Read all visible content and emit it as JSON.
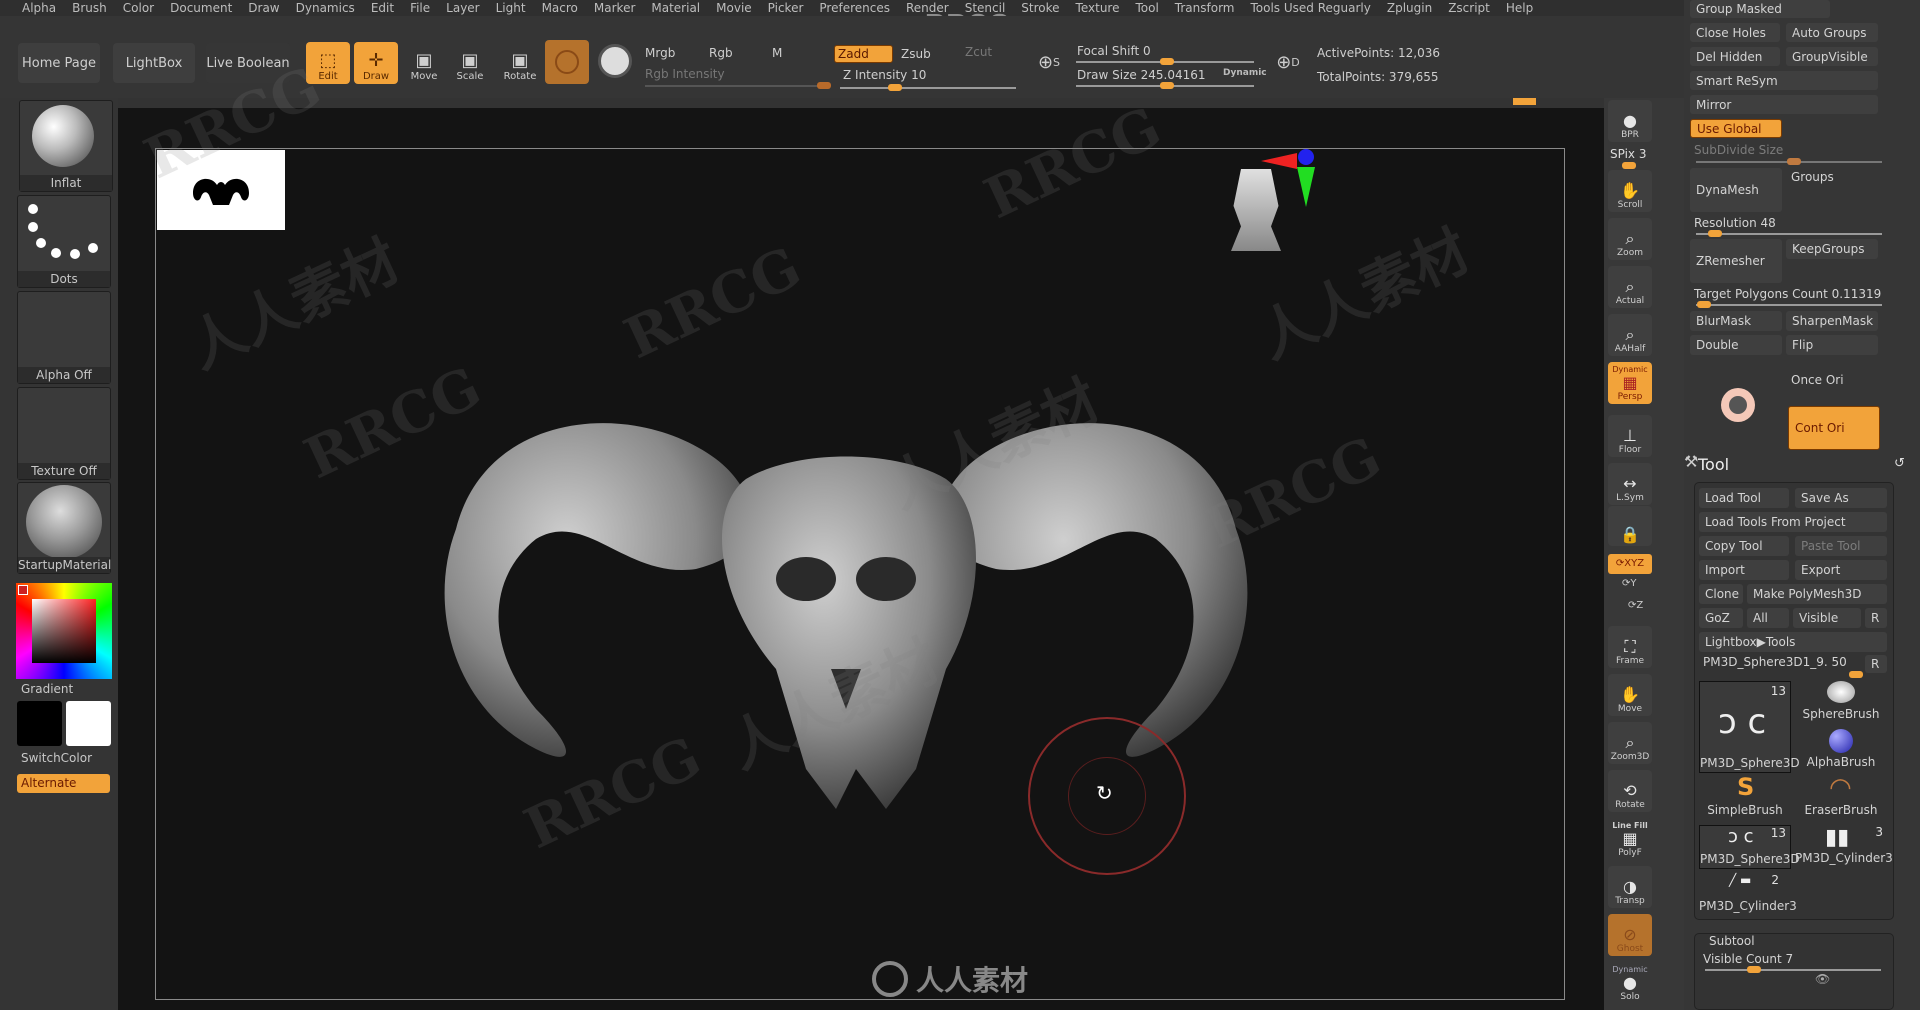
{
  "menu": [
    "Alpha",
    "Brush",
    "Color",
    "Document",
    "Draw",
    "Dynamics",
    "Edit",
    "File",
    "Layer",
    "Light",
    "Macro",
    "Marker",
    "Material",
    "Movie",
    "Picker",
    "Preferences",
    "Render",
    "Stencil",
    "Stroke",
    "Texture",
    "Tool",
    "Transform",
    "Tools Used Reguarly",
    "Zplugin",
    "Zscript",
    "Help"
  ],
  "brand_watermark": "RRCG",
  "toolbar": {
    "home_page": "Home Page",
    "lightbox": "LightBox",
    "live_boolean": "Live Boolean",
    "edit": "Edit",
    "draw": "Draw",
    "move": "Move",
    "scale": "Scale",
    "rotate": "Rotate",
    "mrgb": "Mrgb",
    "rgb": "Rgb",
    "m": "M",
    "rgb_intensity": "Rgb Intensity",
    "zadd": "Zadd",
    "zsub": "Zsub",
    "zcut": "Zcut",
    "z_intensity": "Z Intensity 10",
    "focal_shift": "Focal Shift 0",
    "draw_size": "Draw Size 245.04161",
    "dynamic": "Dynamic",
    "s_badge": "S",
    "d_badge": "D",
    "active_points": "ActivePoints: 12,036",
    "total_points": "TotalPoints: 379,655"
  },
  "left_shelf": {
    "brush": "Inflat",
    "stroke": "Dots",
    "alpha": "Alpha Off",
    "texture": "Texture Off",
    "material": "StartupMaterial",
    "gradient": "Gradient",
    "switch_color": "SwitchColor",
    "alternate": "Alternate",
    "main_color": "#000000",
    "secondary_color": "#ffffff"
  },
  "right_shelf": {
    "bpr": "BPR",
    "spix": "SPix 3",
    "scroll": "Scroll",
    "zoom": "Zoom",
    "actual": "Actual",
    "aahalf": "AAHalf",
    "persp": "Persp",
    "persp_top": "Dynamic",
    "floor": "Floor",
    "lsym": "L.Sym",
    "xyz": "XYZ",
    "y": "Y",
    "z": "Z",
    "frame": "Frame",
    "move": "Move",
    "zoom3d": "Zoom3D",
    "rotate": "Rotate",
    "linefill": "Line Fill",
    "polyf": "PolyF",
    "transp": "Transp",
    "ghost": "Ghost",
    "solo_top": "Dynamic",
    "solo": "Solo"
  },
  "right_panel": {
    "group_masked": "Group Masked",
    "close_holes": "Close Holes",
    "auto_groups": "Auto Groups",
    "del_hidden": "Del Hidden",
    "group_visible": "GroupVisible",
    "smart_resym": "Smart ReSym",
    "mirror": "Mirror",
    "use_global": "Use Global",
    "subdivide_size": "SubDivide Size",
    "dynamesh": "DynaMesh",
    "groups": "Groups",
    "resolution": "Resolution 48",
    "zremesher": "ZRemesher",
    "keepgroups": "KeepGroups",
    "target_poly": "Target Polygons Count 0.11319",
    "blurmask": "BlurMask",
    "sharpenmask": "SharpenMask",
    "double": "Double",
    "flip": "Flip",
    "once_ori": "Once Ori",
    "cont_ori": "Cont Ori",
    "tool_title": "Tool",
    "load_tool": "Load Tool",
    "save_as": "Save As",
    "load_tools_project": "Load Tools From Project",
    "copy_tool": "Copy Tool",
    "paste_tool": "Paste Tool",
    "import": "Import",
    "export": "Export",
    "clone": "Clone",
    "make_polymesh": "Make PolyMesh3D",
    "goz": "GoZ",
    "all": "All",
    "visible": "Visible",
    "r": "R",
    "lightbox_tools": "Lightbox▶Tools",
    "current_tool": "PM3D_Sphere3D1_9. 50",
    "brushes": [
      {
        "name": "PM3D_Sphere3D",
        "count": "13"
      },
      {
        "name": "SphereBrush",
        "count": ""
      },
      {
        "name": "AlphaBrush",
        "count": ""
      },
      {
        "name": "SimpleBrush",
        "count": ""
      },
      {
        "name": "EraserBrush",
        "count": ""
      },
      {
        "name": "PM3D_Sphere3D",
        "count": "13"
      },
      {
        "name": "PM3D_Cylinder3",
        "count": "3"
      },
      {
        "name": "PM3D_Cylinder3",
        "count": "2"
      }
    ],
    "subtool": "Subtool",
    "visible_count": "Visible Count 7"
  },
  "canvas": {
    "footer_brand": "人人素材",
    "watermark_cn": "人人素材",
    "watermark_en": "RRCG"
  },
  "colors": {
    "accent": "#f2a33a",
    "panel": "#363636",
    "canvas": "#131313"
  }
}
